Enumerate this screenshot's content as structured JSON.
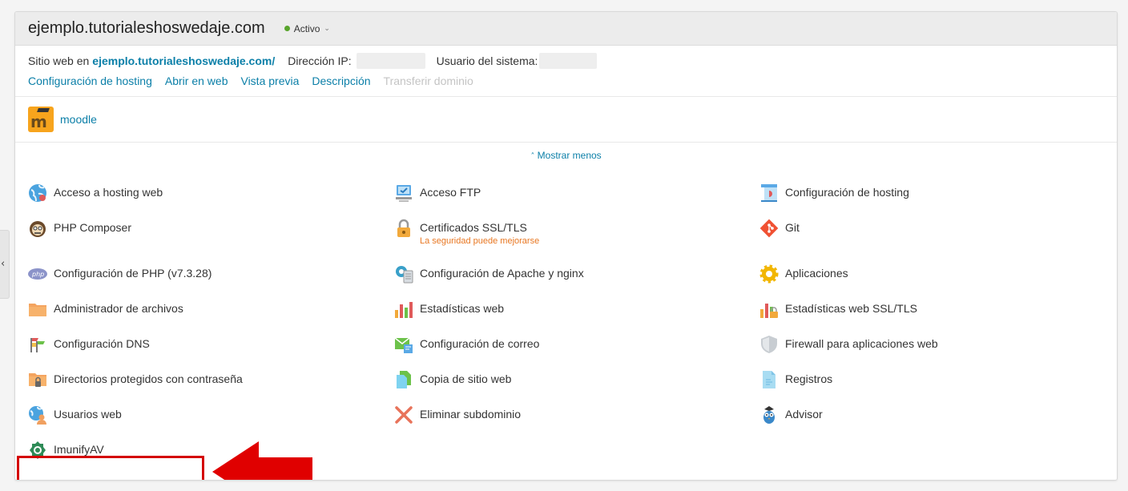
{
  "header": {
    "domain": "ejemplo.tutorialeshoswedaje.com",
    "status": "Activo",
    "status_color": "#58a42c"
  },
  "info": {
    "site_prefix": "Sitio web en",
    "site_link": "ejemplo.tutorialeshoswedaje.com/",
    "ip_label": "Dirección IP:",
    "user_label": "Usuario del sistema:"
  },
  "links": [
    {
      "label": "Configuración de hosting",
      "enabled": true
    },
    {
      "label": "Abrir en web",
      "enabled": true
    },
    {
      "label": "Vista previa",
      "enabled": true
    },
    {
      "label": "Descripción",
      "enabled": true
    },
    {
      "label": "Transferir dominio",
      "enabled": false
    }
  ],
  "app": {
    "name": "moodle"
  },
  "toggle": {
    "label": "Mostrar menos"
  },
  "tools": {
    "col1": [
      {
        "label": "Acceso a hosting web",
        "icon": "globe-icon"
      },
      {
        "label": "PHP Composer",
        "icon": "composer-icon"
      },
      {
        "label": "Configuración de PHP (v7.3.28)",
        "icon": "php-icon"
      },
      {
        "label": "Administrador de archivos",
        "icon": "folder-icon"
      },
      {
        "label": "Configuración DNS",
        "icon": "dns-flags-icon"
      },
      {
        "label": "Directorios protegidos con contraseña",
        "icon": "locked-folder-icon"
      },
      {
        "label": "Usuarios web",
        "icon": "web-users-icon"
      },
      {
        "label": "ImunifyAV",
        "icon": "imunify-icon"
      }
    ],
    "col2": [
      {
        "label": "Acceso FTP",
        "icon": "ftp-icon"
      },
      {
        "label": "Certificados SSL/TLS",
        "icon": "padlock-icon",
        "sub": "La seguridad puede mejorarse"
      },
      {
        "label": "Configuración de Apache y nginx",
        "icon": "apache-nginx-icon"
      },
      {
        "label": "Estadísticas web",
        "icon": "bar-stats-icon"
      },
      {
        "label": "Configuración de correo",
        "icon": "mail-icon"
      },
      {
        "label": "Copia de sitio web",
        "icon": "copy-icon"
      },
      {
        "label": "Eliminar subdominio",
        "icon": "delete-x-icon"
      }
    ],
    "col3": [
      {
        "label": "Configuración de hosting",
        "icon": "hosting-config-icon"
      },
      {
        "label": "Git",
        "icon": "git-icon"
      },
      {
        "label": "Aplicaciones",
        "icon": "gear-icon"
      },
      {
        "label": "Estadísticas web SSL/TLS",
        "icon": "ssl-stats-icon"
      },
      {
        "label": "Firewall para aplicaciones web",
        "icon": "shield-icon"
      },
      {
        "label": "Registros",
        "icon": "logs-icon"
      },
      {
        "label": "Advisor",
        "icon": "owl-icon"
      }
    ]
  },
  "colors": {
    "link": "#0b7fa8",
    "warning": "#e87722",
    "highlight": "#d40000"
  }
}
